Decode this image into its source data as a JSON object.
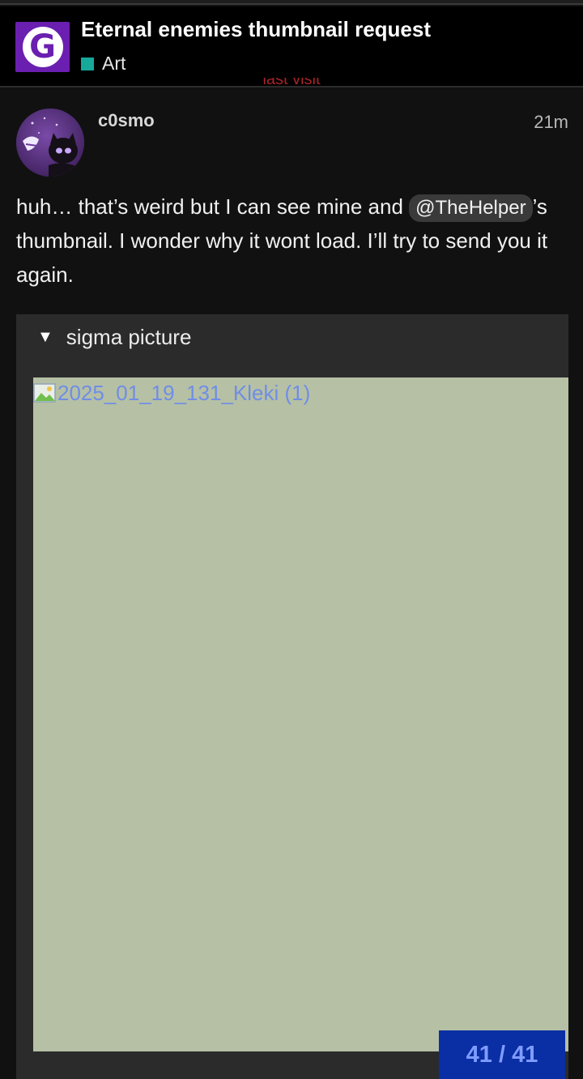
{
  "header": {
    "logo_letter": "G",
    "title": "Eternal enemies thumbnail request",
    "category": "Art",
    "category_color": "#17a89c",
    "logo_color": "#6a1fb0"
  },
  "divider": {
    "label": "last visit",
    "color": "#a8232a"
  },
  "post": {
    "username": "c0smo",
    "time": "21m",
    "avatar_icon": "avatar-cat-icon",
    "body_before": "huh… that’s weird but I can see mine and ",
    "mention": "@TheHelper",
    "body_after": "’s thumbnail. I wonder why it wont load. I’ll try to send you it again."
  },
  "details": {
    "summary": "sigma picture",
    "toggle_icon": "triangle-down-icon",
    "image_alt": "2025_01_19_131_Kleki (1)",
    "image_icon": "broken-image-icon"
  },
  "progress": {
    "counter": "41 / 41"
  }
}
